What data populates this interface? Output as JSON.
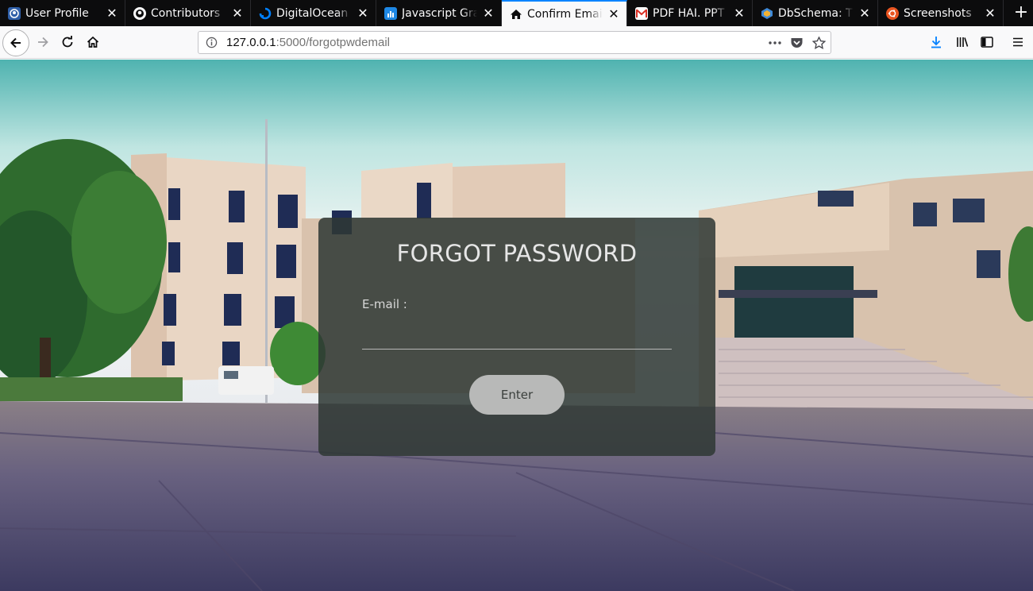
{
  "browser": {
    "tabs": [
      {
        "title": "User Profile",
        "icon": "user-profile-favicon",
        "active": false
      },
      {
        "title": "Contributors",
        "icon": "github-icon",
        "active": false
      },
      {
        "title": "DigitalOcean",
        "icon": "digitalocean-icon",
        "active": false
      },
      {
        "title": "Javascript Gra",
        "icon": "chart-icon",
        "active": false
      },
      {
        "title": "Confirm Email",
        "icon": "home-icon",
        "active": true
      },
      {
        "title": "PDF HAI. PPT",
        "icon": "gmail-icon",
        "active": false
      },
      {
        "title": "DbSchema: Th",
        "icon": "dbschema-icon",
        "active": false
      },
      {
        "title": "Screenshots",
        "icon": "ubuntu-icon",
        "active": false
      }
    ],
    "url_host": "127.0.0.1",
    "url_path": ":5000/forgotpwdemail",
    "accent_color": "#0a84ff"
  },
  "page": {
    "title": "FORGOT PASSWORD",
    "email_label": "E-mail :",
    "email_value": "",
    "submit_label": "Enter"
  }
}
